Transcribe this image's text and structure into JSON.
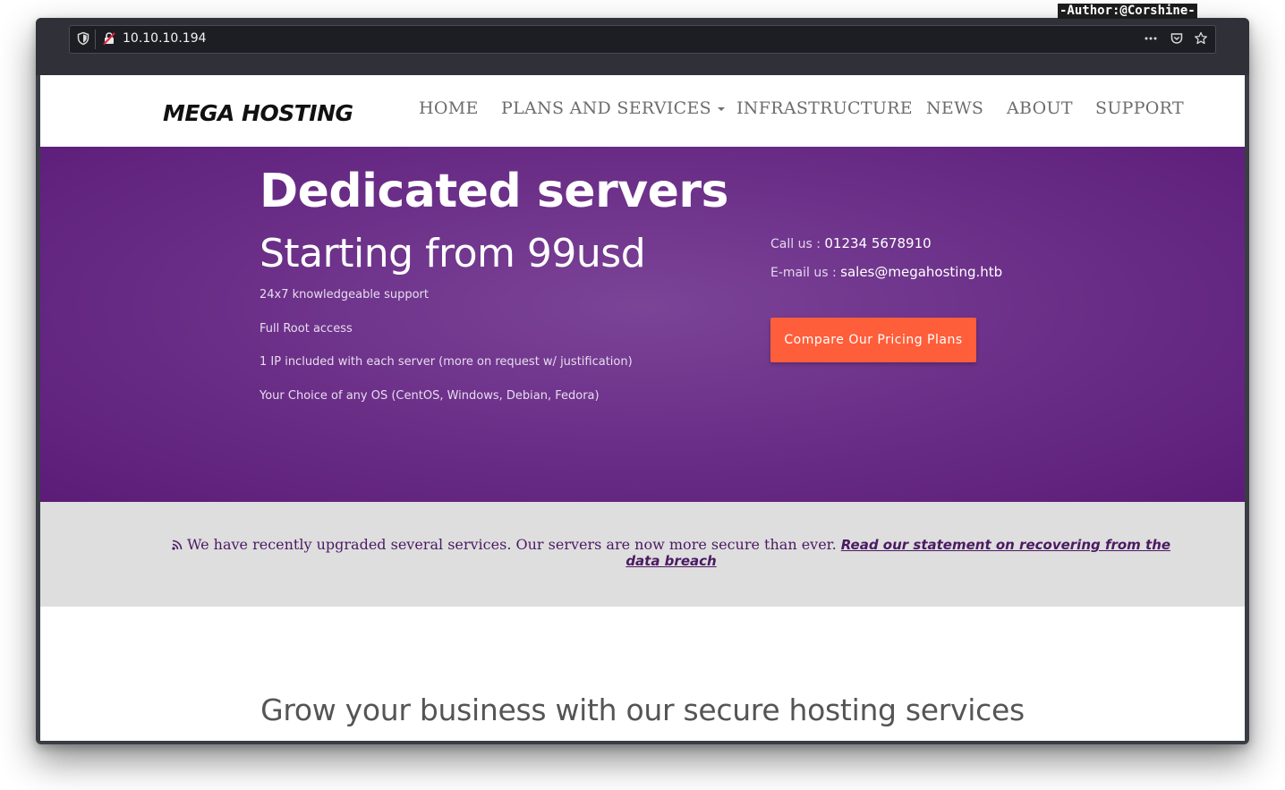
{
  "watermark": {
    "author": "-Author:@Corshine-"
  },
  "browser": {
    "url": "10.10.10.194",
    "icons": [
      "shield-icon",
      "insecure-lock-icon",
      "more-actions-icon",
      "pocket-icon",
      "bookmark-star-icon"
    ]
  },
  "site": {
    "logo": "MEGA HOSTING",
    "nav": {
      "home": "HOME",
      "plans": "PLANS AND SERVICES",
      "infrastructure": "INFRASTRUCTURE",
      "news": "NEWS",
      "about": "ABOUT",
      "support": "SUPPORT"
    },
    "hero": {
      "title": "Dedicated servers",
      "subtitle": "Starting from 99usd",
      "features": [
        "24x7 knowledgeable support",
        "Full Root access",
        "1 IP included with each server (more on request w/ justification)",
        "Your Choice of any OS (CentOS, Windows, Debian, Fedora)"
      ],
      "call_label": "Call us : ",
      "call_value": "01234 5678910",
      "email_label": "E-mail us : ",
      "email_value": "sales@megahosting.htb",
      "cta": "Compare Our Pricing Plans"
    },
    "announcement": {
      "text": "We have recently upgraded several services. Our servers are now more secure than ever.",
      "link": "Read our statement on recovering from the data breach"
    },
    "section_heading": "Grow your business with our secure hosting services"
  },
  "colors": {
    "hero_purple": "#6c3089",
    "cta_orange": "#ff5e3a",
    "announce_bg": "#dedede",
    "announce_text": "#4b1a63"
  }
}
